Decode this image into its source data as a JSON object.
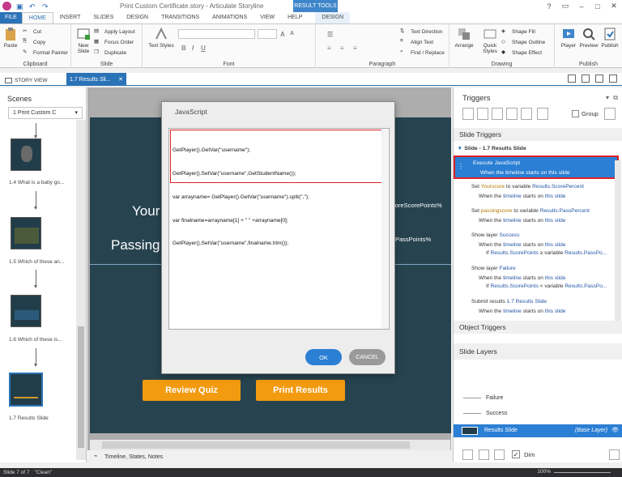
{
  "titlebar": {
    "title": "Print Custom Certificate.story - Articulate Storyline",
    "context_tab": "RESULT TOOLS"
  },
  "tabs": [
    "FILE",
    "HOME",
    "INSERT",
    "SLIDES",
    "DESIGN",
    "TRANSITIONS",
    "ANIMATIONS",
    "VIEW",
    "HELP",
    "DESIGN"
  ],
  "ribbon": {
    "clipboard": {
      "paste": "Paste",
      "cut": "Cut",
      "copy": "Copy",
      "format_painter": "Format Painter",
      "label": "Clipboard"
    },
    "slide": {
      "new_slide": "New Slide",
      "apply_layout": "Apply Layout",
      "focus_order": "Focus Order",
      "duplicate": "Duplicate",
      "label": "Slide"
    },
    "font": {
      "text_styles": "Text Styles",
      "label": "Font"
    },
    "paragraph": {
      "text_direction": "Text Direction",
      "align_text": "Align Text",
      "find_replace": "Find / Replace",
      "label": "Paragraph"
    },
    "drawing": {
      "arrange": "Arrange",
      "quick_styles": "Quick Styles",
      "shape_fill": "Shape Fill",
      "shape_outline": "Shape Outline",
      "shape_effect": "Shape Effect",
      "label": "Drawing"
    },
    "publish": {
      "player": "Player",
      "preview": "Preview",
      "publish": "Publish",
      "label": "Publish"
    }
  },
  "viewbar": {
    "story_view": "STORY VIEW",
    "slide_tab": "1.7 Results Sli..."
  },
  "scenes": {
    "header": "Scenes",
    "selected_scene": "1 Print Custom C",
    "items": [
      "1.4 What is a baby go...",
      "1.5 Which of these an...",
      "1.6 Which of these is...",
      "1.7 Results Slide"
    ]
  },
  "slide": {
    "your_text": "Your",
    "passing_text": "Passing",
    "score_points": "coreScorePoints%",
    "pass_points": "PassPoints%",
    "review_btn": "Review Quiz",
    "print_btn": "Print Results"
  },
  "timeline": "Timeline, States, Notes",
  "dialog": {
    "title": "JavaScript",
    "code": [
      "GetPlayer().GetVar(\"username\");",
      "GetPlayer().SetVar(\"username\",GetStudentName());",
      "var arrayname= GetPlayer().GetVar(\"username\").split(\",\");",
      "var finalname=arrayname[1] + \" \" +arrayname[0];",
      "GetPlayer().SetVar(\"username\",finalname.trim());"
    ],
    "ok": "OK",
    "cancel": "CANCEL"
  },
  "triggers": {
    "header": "Triggers",
    "group_label": "Group",
    "slide_triggers": "Slide Triggers",
    "slide_sub": "Slide - 1.7 Results Slide",
    "selected": {
      "action": "Execute JavaScript",
      "cond": "When the timeline starts on this slide"
    },
    "items": [
      {
        "a1": "Set ",
        "k": "Yourscore",
        "a2": " to variable ",
        "b": "Results.ScorePercent",
        "w": "When the ",
        "w_b": "timeline",
        "w2": " starts on ",
        "w_b2": "this slide"
      },
      {
        "a1": "Set ",
        "k": "passingscore",
        "a2": " to variable ",
        "b": "Results.PassPercent",
        "w": "When the ",
        "w_b": "timeline",
        "w2": " starts on ",
        "w_b2": "this slide"
      },
      {
        "a1": "Show layer ",
        "b": "Success",
        "w": "When the ",
        "w_b": "timeline",
        "w2": " starts on ",
        "w_b2": "this slide",
        "if1": "If ",
        "if_b": "Results.ScorePoints",
        "if2": " ≥ variable ",
        "if_b2": "Results.PassPo..."
      },
      {
        "a1": "Show layer ",
        "b": "Failure",
        "w": "When the ",
        "w_b": "timeline",
        "w2": " starts on ",
        "w_b2": "this slide",
        "if1": "If ",
        "if_b": "Results.ScorePoints",
        "if2": " < variable ",
        "if_b2": "Results.PassPo..."
      },
      {
        "a1": "Submit results ",
        "b": "1.7 Results Slide",
        "w": "When the ",
        "w_b": "timeline",
        "w2": " starts on ",
        "w_b2": "this slide"
      }
    ],
    "object_triggers": "Object Triggers"
  },
  "layers": {
    "header": "Slide Layers",
    "failure": "Failure",
    "success": "Success",
    "base_name": "Results Slide",
    "base_tag": "(Base Layer)",
    "dim": "Dim"
  },
  "status": {
    "slide": "Slide 7 of 7",
    "theme": "\"Clean\"",
    "zoom": "100%"
  }
}
